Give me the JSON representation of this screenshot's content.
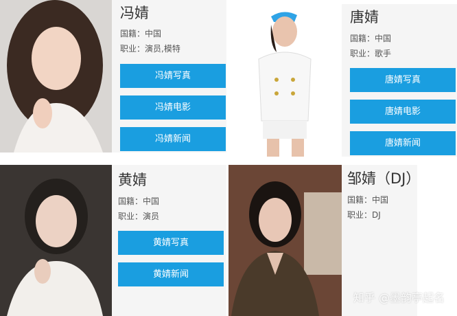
{
  "cards": [
    {
      "name": "冯婧",
      "nationality": "国籍：中国",
      "profession": "职业：演员,模特",
      "buttons": [
        "冯婧写真",
        "冯婧电影",
        "冯婧新闻"
      ]
    },
    {
      "name": "唐婧",
      "nationality": "国籍：中国",
      "profession": "职业：歌手",
      "buttons": [
        "唐婧写真",
        "唐婧电影",
        "唐婧新闻"
      ]
    },
    {
      "name": "黄婧",
      "nationality": "国籍：中国",
      "profession": "职业：演员",
      "buttons": [
        "黄婧写真",
        "黄婧新闻"
      ]
    },
    {
      "name": "邹婧（DJ）",
      "nationality": "国籍：中国",
      "profession": "职业：DJ",
      "buttons": []
    }
  ],
  "watermark": "知乎 @墨韵亭起名",
  "colors": {
    "button": "#1a9ee0",
    "panel": "#f5f5f5"
  }
}
